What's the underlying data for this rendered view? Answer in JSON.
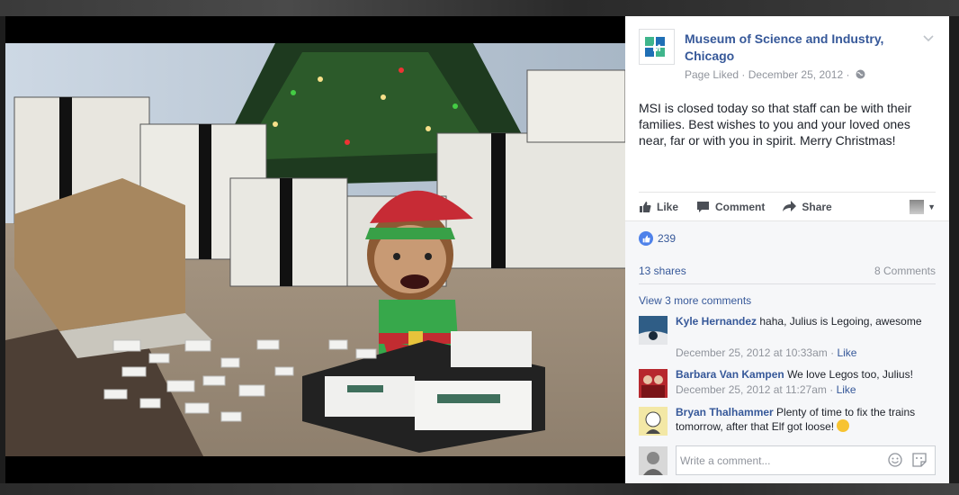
{
  "post": {
    "page_name": "Museum of Science and Industry, Chicago",
    "status": "Page Liked",
    "separator": "·",
    "date": "December 25, 2012",
    "separator2": "·",
    "text": "MSI is closed today so that staff can be with their families. Best wishes to you and your loved ones near, far or with you in spirit. Merry Christmas!"
  },
  "actions": {
    "like": "Like",
    "comment": "Comment",
    "share": "Share"
  },
  "stats": {
    "likes": "239",
    "shares": "13 shares",
    "comments": "8 Comments",
    "view_more": "View 3 more comments"
  },
  "comments": [
    {
      "name": "Kyle Hernandez",
      "text": "haha, Julius is Legoing, awesome",
      "time": "December 25, 2012 at 10:33am",
      "sep": "·",
      "like": "Like"
    },
    {
      "name": "Barbara Van Kampen",
      "text": "We love Legos too, Julius!",
      "time": "December 25, 2012 at 11:27am",
      "sep": "·",
      "like": "Like"
    },
    {
      "name": "Bryan Thalhammer",
      "text": "Plenty of time to fix the trains tomorrow, after that Elf got loose!",
      "time": "",
      "sep": "",
      "like": ""
    }
  ],
  "write_comment": {
    "placeholder": "Write a comment..."
  },
  "icons": {
    "logo": "msi-logo-icon",
    "globe": "globe-icon",
    "like": "thumbs-up-icon",
    "comment": "comment-bubble-icon",
    "share": "share-arrow-icon",
    "camera": "camera-icon",
    "sticker": "sticker-icon"
  },
  "colors": {
    "link": "#365899",
    "meta": "#90949c",
    "like_badge": "#4f82ea",
    "logo_green": "#3fb58c",
    "logo_blue": "#1f6fb5"
  }
}
